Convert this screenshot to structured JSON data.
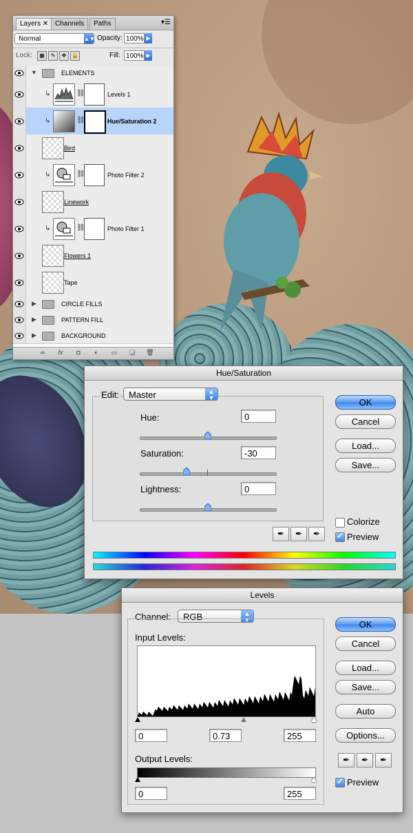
{
  "layers_panel": {
    "tabs": [
      "Layers",
      "Channels",
      "Paths"
    ],
    "blend_mode": "Normal",
    "opacity_label": "Opacity:",
    "opacity_value": "100%",
    "lock_label": "Lock:",
    "fill_label": "Fill:",
    "fill_value": "100%",
    "layers": [
      {
        "name": "ELEMENTS",
        "type": "group-open"
      },
      {
        "name": "Levels 1",
        "type": "adjustment"
      },
      {
        "name": "Hue/Saturation 2",
        "type": "adjustment",
        "selected": true
      },
      {
        "name": "Bird",
        "type": "pixel"
      },
      {
        "name": "Photo Filter 2",
        "type": "adjustment"
      },
      {
        "name": "Linework",
        "type": "pixel"
      },
      {
        "name": "Photo Filter 1",
        "type": "adjustment"
      },
      {
        "name": "Flowers 1",
        "type": "pixel"
      },
      {
        "name": "Tape",
        "type": "pixel"
      },
      {
        "name": "CIRCLE FILLS",
        "type": "group"
      },
      {
        "name": "PATTERN FILL",
        "type": "group"
      },
      {
        "name": "BACKGROUND",
        "type": "group"
      }
    ],
    "footer_icons": [
      "link-icon",
      "fx-icon",
      "mask-icon",
      "adjustment-icon",
      "folder-icon",
      "new-layer-icon",
      "trash-icon"
    ]
  },
  "hue_saturation": {
    "title": "Hue/Saturation",
    "edit_label": "Edit:",
    "edit_value": "Master",
    "hue_label": "Hue:",
    "hue_value": "0",
    "saturation_label": "Saturation:",
    "saturation_value": "-30",
    "lightness_label": "Lightness:",
    "lightness_value": "0",
    "ok": "OK",
    "cancel": "Cancel",
    "load": "Load...",
    "save": "Save...",
    "colorize_label": "Colorize",
    "colorize_checked": false,
    "preview_label": "Preview",
    "preview_checked": true
  },
  "levels": {
    "title": "Levels",
    "channel_label": "Channel:",
    "channel_value": "RGB",
    "input_levels_label": "Input Levels:",
    "input_black": "0",
    "input_gamma": "0.73",
    "input_white": "255",
    "output_levels_label": "Output Levels:",
    "output_black": "0",
    "output_white": "255",
    "ok": "OK",
    "cancel": "Cancel",
    "load": "Load...",
    "save": "Save...",
    "auto": "Auto",
    "options": "Options...",
    "preview_label": "Preview",
    "preview_checked": true
  },
  "colors": {
    "selected_layer": "#b8d4fb",
    "default_button": "#3d86ec"
  }
}
